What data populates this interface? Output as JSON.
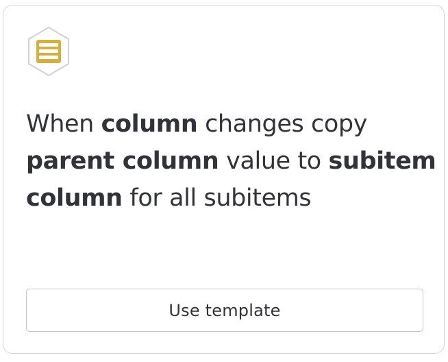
{
  "card": {
    "icon": "subitems-list-icon",
    "accent_color": "#d4b13c",
    "recipe_segments": [
      {
        "text": "When ",
        "bold": false
      },
      {
        "text": "column",
        "bold": true
      },
      {
        "text": " changes copy ",
        "bold": false
      },
      {
        "text": "parent column",
        "bold": true
      },
      {
        "text": " value to ",
        "bold": false
      },
      {
        "text": "subitem column",
        "bold": true
      },
      {
        "text": " for all subitems",
        "bold": false
      }
    ],
    "button_label": "Use template"
  }
}
